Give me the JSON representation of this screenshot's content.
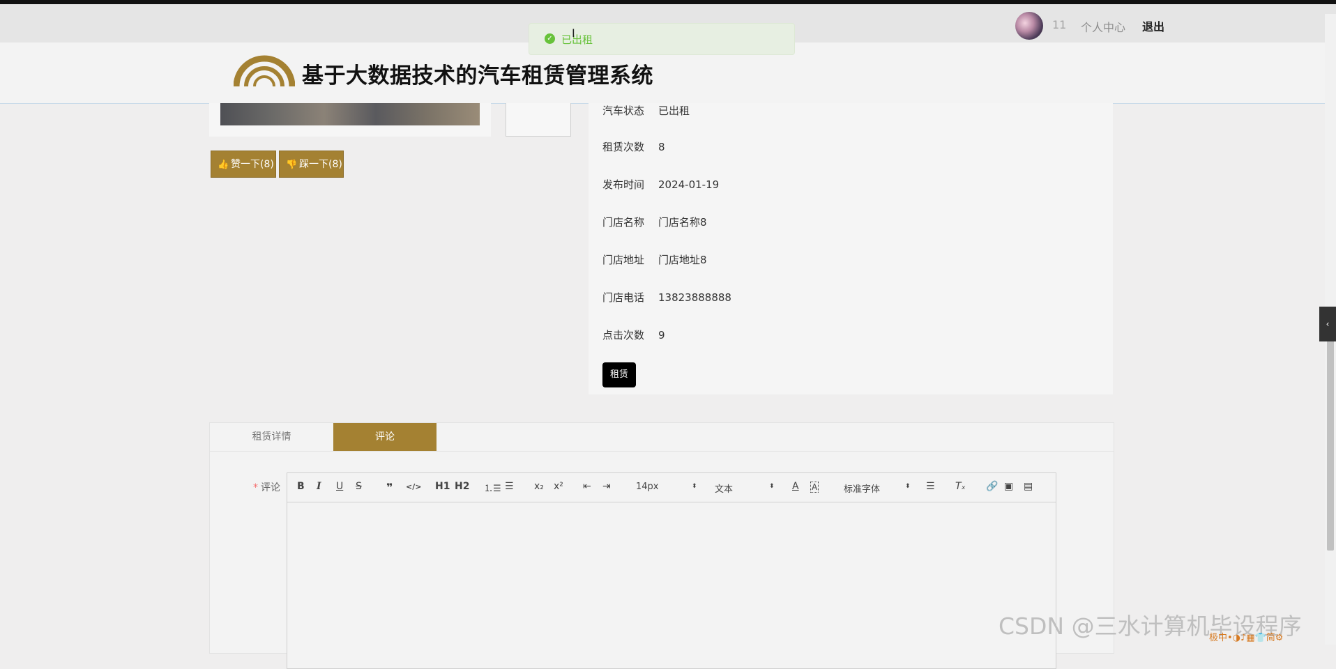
{
  "topbar": {
    "username": "11",
    "personal_center": "个人中心",
    "logout": "退出"
  },
  "toast": {
    "message": "已出租",
    "icon": "success-check-icon"
  },
  "header": {
    "title": "基于大数据技术的汽车租赁管理系统",
    "accent_color": "#a48132"
  },
  "votes": {
    "like_label": "赞一下(8)",
    "dislike_label": "踩一下(8)"
  },
  "details": [
    {
      "label": "汽车状态",
      "value": "已出租"
    },
    {
      "label": "租赁次数",
      "value": "8"
    },
    {
      "label": "发布时间",
      "value": "2024-01-19"
    },
    {
      "label": "门店名称",
      "value": "门店名称8"
    },
    {
      "label": "门店地址",
      "value": "门店地址8"
    },
    {
      "label": "门店电话",
      "value": "13823888888"
    },
    {
      "label": "点击次数",
      "value": "9"
    }
  ],
  "rent_button": "租赁",
  "tabs": {
    "details": "租赁详情",
    "comment": "评论"
  },
  "form": {
    "required_mark": "*",
    "comment_label": "评论"
  },
  "editor": {
    "font_size": "14px",
    "text_type": "文本",
    "font_family": "标准字体",
    "h1": "H1",
    "h2": "H2"
  },
  "watermark": "CSDN @三水计算机毕设程序",
  "ime": "极中•◑♪▦👕简⚙"
}
